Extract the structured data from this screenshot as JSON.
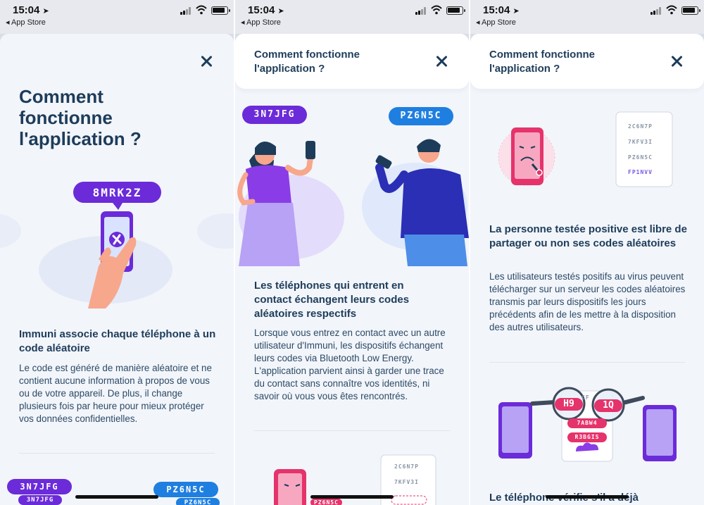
{
  "status_bar": {
    "time": "15:04",
    "back_label": "◂ App Store"
  },
  "screen1": {
    "title": "Comment fonctionne l'application ?",
    "code_badge": "8MRK2Z",
    "heading": "Immuni associe chaque téléphone à un code aléatoire",
    "body": "Le code est généré de manière aléatoire et ne contient aucune information à propos de vous ou de votre appareil. De plus, il change plusieurs fois par heure pour mieux protéger vos données confidentielles.",
    "bottom_badges": [
      "3N7JFG",
      "3N7JFG",
      "PZ6N5C",
      "PZ6N5C"
    ]
  },
  "screen2": {
    "nav_title": "Comment fonctionne l'application ?",
    "badge_left": "3N7JFG",
    "badge_right": "PZ6N5C",
    "heading": "Les téléphones qui entrent en contact échangent leurs codes aléatoires respectifs",
    "body": "Lorsque vous entrez en contact avec un autre utilisateur d'Immuni, les dispositifs échangent leurs codes via Bluetooth Low Energy. L'application parvient ainsi à garder une trace du contact sans connaître vos identités, ni savoir où vous vous êtes rencontrés.",
    "preview_codes": [
      "2C6N7P",
      "7KFV3I",
      "PZ6N5C"
    ]
  },
  "screen3": {
    "nav_title": "Comment fonctionne l'application ?",
    "doc_codes": [
      "2C6N7P",
      "7KFV3I",
      "PZ6N5C",
      "FP1NVV"
    ],
    "heading": "La personne testée positive est libre de partager ou non ses codes aléatoires",
    "body": "Les utilisateurs testés positifs au virus peuvent télécharger sur un serveur les codes aléatoires transmis par leurs dispositifs les jours précédents afin de les mettre à la disposition des autres utilisateurs.",
    "lens_codes": [
      "H9",
      "1Q"
    ],
    "server_codes": [
      "7ABW4",
      "R3BGIS",
      "CF"
    ],
    "next_heading": "Le téléphone vérifie s'il a déjà"
  },
  "colors": {
    "accent_purple": "#6b2bd9",
    "accent_blue": "#1f7fe0",
    "heading": "#1d3c5a",
    "pink": "#e5336b",
    "sheet_bg": "#f2f5fa"
  }
}
